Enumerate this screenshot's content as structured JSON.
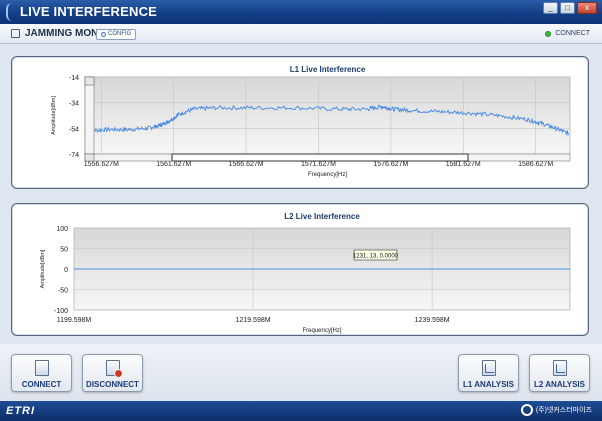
{
  "window": {
    "title": "LIVE INTERFERENCE",
    "controls": [
      "_",
      "□",
      "x"
    ]
  },
  "toolbar": {
    "app_name": "JAMMING MON",
    "config_label": "CONFIG",
    "status_label": "CONNECT",
    "status_color": "#3cbc3c"
  },
  "chart_data": [
    {
      "type": "line",
      "title": "L1 Live Interference",
      "xlabel": "Frequency[Hz]",
      "ylabel": "Amplitude[dBm]",
      "y_ticks": [
        "-14",
        "-34",
        "-54",
        "-74"
      ],
      "y_tick_values": [
        -14,
        -34,
        -54,
        -74
      ],
      "x_ticks": [
        "1556.627M",
        "1561.627M",
        "1566.627M",
        "1571.627M",
        "1576.627M",
        "1581.627M",
        "1586.627M"
      ],
      "x_tick_values": [
        1556.627,
        1561.627,
        1566.627,
        1571.627,
        1576.627,
        1581.627,
        1586.627
      ],
      "xlim": [
        1555.5,
        1589.0
      ],
      "ylim": [
        -74,
        -14
      ],
      "grid": true,
      "series": [
        {
          "color": "#3f86e6",
          "x": [
            1555.6,
            1557.0,
            1558.5,
            1559.8,
            1560.6,
            1561.2,
            1562.0,
            1563.0,
            1564.5,
            1567.0,
            1570.0,
            1573.0,
            1575.0,
            1576.0,
            1576.8,
            1578.0,
            1580.0,
            1582.0,
            1584.0,
            1586.0,
            1587.0,
            1588.0,
            1588.9
          ],
          "y": [
            -56,
            -55,
            -55,
            -54,
            -52,
            -49,
            -43,
            -39,
            -38,
            -38,
            -38,
            -39,
            -39,
            -37,
            -39,
            -40,
            -41,
            -42,
            -44,
            -47,
            -50,
            -54,
            -58
          ]
        }
      ]
    },
    {
      "type": "line",
      "title": "L2 Live Interference",
      "xlabel": "Frequency[Hz]",
      "ylabel": "Amplitude[dBm]",
      "y_ticks": [
        "100",
        "50",
        "0",
        "-50",
        "-100"
      ],
      "y_tick_values": [
        100,
        50,
        0,
        -50,
        -100
      ],
      "x_ticks": [
        "1199.598M",
        "1219.598M",
        "1239.598M"
      ],
      "x_tick_values": [
        1199.598,
        1219.598,
        1239.598
      ],
      "xlim": [
        1199.598,
        1255.0
      ],
      "ylim": [
        -100,
        100
      ],
      "grid": true,
      "tooltip": "1231, 13, 0.0000",
      "series": [
        {
          "color": "#4a8fe7",
          "x": [
            1199.598,
            1255.0
          ],
          "y": [
            0,
            0
          ]
        }
      ]
    }
  ],
  "buttons": {
    "connect": "CONNECT",
    "disconnect": "DISCONNECT",
    "l1_analysis": "L1 ANALYSIS",
    "l2_analysis": "L2 ANALYSIS"
  },
  "footer": {
    "brand": "ETRI",
    "company": "(주)넷커스터마이즈"
  }
}
